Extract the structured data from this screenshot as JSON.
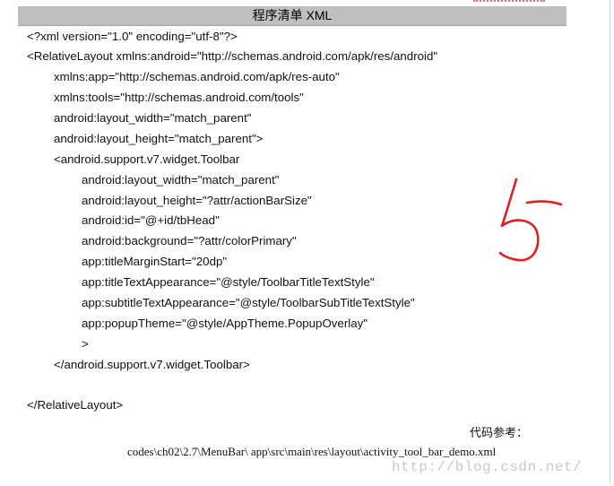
{
  "header": {
    "title": "程序清单  XML"
  },
  "code_lines": [
    "<?xml version=\"1.0\" encoding=\"utf-8\"?>",
    "<RelativeLayout xmlns:android=\"http://schemas.android.com/apk/res/android\"",
    "xmlns:app=\"http://schemas.android.com/apk/res-auto\"",
    "xmlns:tools=\"http://schemas.android.com/tools\"",
    "android:layout_width=\"match_parent\"",
    "android:layout_height=\"match_parent\">",
    "<android.support.v7.widget.Toolbar",
    "android:layout_width=\"match_parent\"",
    "android:layout_height=\"?attr/actionBarSize\"",
    "android:id=\"@+id/tbHead\"",
    "android:background=\"?attr/colorPrimary\"",
    "app:titleMarginStart=\"20dp\"",
    "app:titleTextAppearance=\"@style/ToolbarTitleTextStyle\"",
    "app:subtitleTextAppearance=\"@style/ToolbarSubTitleTextStyle\"",
    "app:popupTheme=\"@style/AppTheme.PopupOverlay\"",
    ">",
    "</android.support.v7.widget.Toolbar>",
    "</RelativeLayout>"
  ],
  "reference": {
    "label": "代码参考：",
    "path": "codes\\ch02\\2.7\\MenuBar\\ app\\src\\main\\res\\layout\\activity_tool_bar_demo.xml"
  },
  "watermark": "http://blog.csdn.net/",
  "annotation": {
    "handwritten": "5",
    "color": "#e02020"
  },
  "colors": {
    "title_bar": "#bfbfbf"
  }
}
